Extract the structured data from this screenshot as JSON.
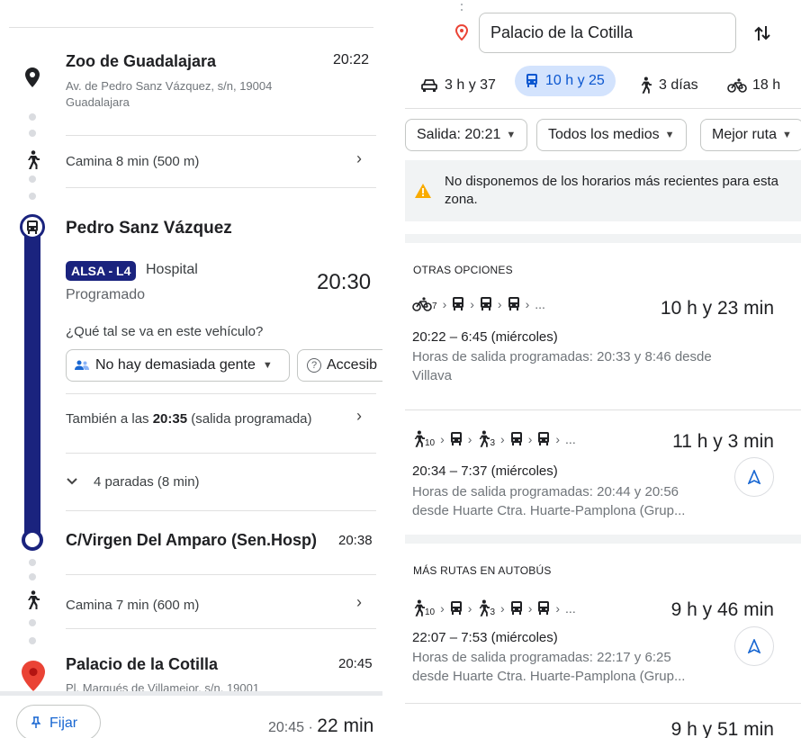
{
  "left": {
    "origin": {
      "name": "Zoo de Guadalajara",
      "time": "20:22",
      "address_line1": "Av. de Pedro Sanz Vázquez, s/n, 19004",
      "address_line2": "Guadalajara"
    },
    "walk1": {
      "label": "Camina 8 min (500 m)"
    },
    "stop": {
      "name": "Pedro Sanz Vázquez"
    },
    "bus": {
      "line_badge": "ALSA - L4",
      "headsign": "Hospital",
      "status": "Programado",
      "time": "20:30",
      "question": "¿Qué tal se va en este vehículo?",
      "crowd_label": "No hay demasiada gente",
      "access_label": "Accesib"
    },
    "also": {
      "prefix": "También a las ",
      "time": "20:35",
      "suffix": " (salida programada)"
    },
    "stops": {
      "label": "4 paradas (8 min)"
    },
    "alight": {
      "name": "C/Virgen Del Amparo (Sen.Hosp)",
      "time": "20:38"
    },
    "walk2": {
      "label": "Camina 7 min (600 m)"
    },
    "destination": {
      "name": "Palacio de la Cotilla",
      "time": "20:45",
      "address": "Pl. Marqués de Villamejor, s/n, 19001"
    },
    "footer": {
      "pin_label": "Fijar",
      "arrival": "20:45 · ",
      "duration": "22 min"
    }
  },
  "right": {
    "search": {
      "destination": "Palacio de la Cotilla"
    },
    "tabs": [
      {
        "label": "3 h y 37",
        "icon": "car-icon"
      },
      {
        "label": "10 h y 25",
        "icon": "transit-icon",
        "selected": true
      },
      {
        "label": "3 días",
        "icon": "walk-icon"
      },
      {
        "label": "18 h",
        "icon": "bike-icon"
      }
    ],
    "filters": {
      "departure": "Salida: 20:21",
      "modes": "Todos los medios",
      "best": "Mejor ruta"
    },
    "notice": "No disponemos de los horarios más recientes para esta zona.",
    "other_section": "OTRAS OPCIONES",
    "more_section": "MÁS RUTAS EN AUTOBÚS",
    "routes": [
      {
        "duration": "10 h y 23 min",
        "times": "20:22 – 6:45 (miércoles)",
        "detail_line1": "Horas de salida programadas: 20:33 y 8:46 desde",
        "detail_line2": "Villava",
        "bike_sub": "7"
      },
      {
        "duration": "11 h y 3 min",
        "times": "20:34 – 7:37 (miércoles)",
        "detail_line1": "Horas de salida programadas: 20:44 y 20:56",
        "detail_line2": "desde Huarte Ctra. Huarte-Pamplona (Grup...",
        "walk_sub1": "10",
        "walk_sub2": "3"
      },
      {
        "duration": "9 h y 46 min",
        "times": "22:07 – 7:53 (miércoles)",
        "detail_line1": "Horas de salida programadas: 22:17 y 6:25",
        "detail_line2": "desde Huarte Ctra. Huarte-Pamplona (Grup...",
        "walk_sub1": "10",
        "walk_sub2": "3"
      },
      {
        "duration": "9 h y 51 min"
      }
    ],
    "ellipsis": "..."
  },
  "colors": {
    "route_line": "#1a237e",
    "accent": "#1967d2",
    "selected_tab_bg": "#d3e3fd",
    "pin_red": "#ea4335",
    "notice_bg": "#f1f3f4"
  }
}
